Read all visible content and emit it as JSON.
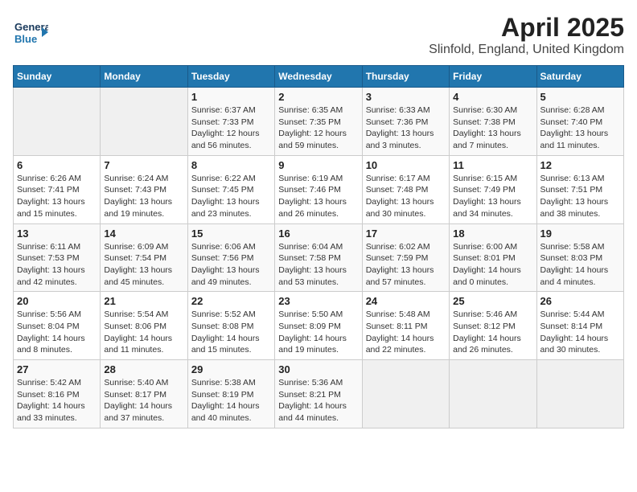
{
  "header": {
    "logo_general": "General",
    "logo_blue": "Blue",
    "title": "April 2025",
    "subtitle": "Slinfold, England, United Kingdom"
  },
  "days_of_week": [
    "Sunday",
    "Monday",
    "Tuesday",
    "Wednesday",
    "Thursday",
    "Friday",
    "Saturday"
  ],
  "weeks": [
    [
      {
        "day": "",
        "empty": true
      },
      {
        "day": "",
        "empty": true
      },
      {
        "day": "1",
        "sunrise": "6:37 AM",
        "sunset": "7:33 PM",
        "daylight": "12 hours and 56 minutes."
      },
      {
        "day": "2",
        "sunrise": "6:35 AM",
        "sunset": "7:35 PM",
        "daylight": "12 hours and 59 minutes."
      },
      {
        "day": "3",
        "sunrise": "6:33 AM",
        "sunset": "7:36 PM",
        "daylight": "13 hours and 3 minutes."
      },
      {
        "day": "4",
        "sunrise": "6:30 AM",
        "sunset": "7:38 PM",
        "daylight": "13 hours and 7 minutes."
      },
      {
        "day": "5",
        "sunrise": "6:28 AM",
        "sunset": "7:40 PM",
        "daylight": "13 hours and 11 minutes."
      }
    ],
    [
      {
        "day": "6",
        "sunrise": "6:26 AM",
        "sunset": "7:41 PM",
        "daylight": "13 hours and 15 minutes."
      },
      {
        "day": "7",
        "sunrise": "6:24 AM",
        "sunset": "7:43 PM",
        "daylight": "13 hours and 19 minutes."
      },
      {
        "day": "8",
        "sunrise": "6:22 AM",
        "sunset": "7:45 PM",
        "daylight": "13 hours and 23 minutes."
      },
      {
        "day": "9",
        "sunrise": "6:19 AM",
        "sunset": "7:46 PM",
        "daylight": "13 hours and 26 minutes."
      },
      {
        "day": "10",
        "sunrise": "6:17 AM",
        "sunset": "7:48 PM",
        "daylight": "13 hours and 30 minutes."
      },
      {
        "day": "11",
        "sunrise": "6:15 AM",
        "sunset": "7:49 PM",
        "daylight": "13 hours and 34 minutes."
      },
      {
        "day": "12",
        "sunrise": "6:13 AM",
        "sunset": "7:51 PM",
        "daylight": "13 hours and 38 minutes."
      }
    ],
    [
      {
        "day": "13",
        "sunrise": "6:11 AM",
        "sunset": "7:53 PM",
        "daylight": "13 hours and 42 minutes."
      },
      {
        "day": "14",
        "sunrise": "6:09 AM",
        "sunset": "7:54 PM",
        "daylight": "13 hours and 45 minutes."
      },
      {
        "day": "15",
        "sunrise": "6:06 AM",
        "sunset": "7:56 PM",
        "daylight": "13 hours and 49 minutes."
      },
      {
        "day": "16",
        "sunrise": "6:04 AM",
        "sunset": "7:58 PM",
        "daylight": "13 hours and 53 minutes."
      },
      {
        "day": "17",
        "sunrise": "6:02 AM",
        "sunset": "7:59 PM",
        "daylight": "13 hours and 57 minutes."
      },
      {
        "day": "18",
        "sunrise": "6:00 AM",
        "sunset": "8:01 PM",
        "daylight": "14 hours and 0 minutes."
      },
      {
        "day": "19",
        "sunrise": "5:58 AM",
        "sunset": "8:03 PM",
        "daylight": "14 hours and 4 minutes."
      }
    ],
    [
      {
        "day": "20",
        "sunrise": "5:56 AM",
        "sunset": "8:04 PM",
        "daylight": "14 hours and 8 minutes."
      },
      {
        "day": "21",
        "sunrise": "5:54 AM",
        "sunset": "8:06 PM",
        "daylight": "14 hours and 11 minutes."
      },
      {
        "day": "22",
        "sunrise": "5:52 AM",
        "sunset": "8:08 PM",
        "daylight": "14 hours and 15 minutes."
      },
      {
        "day": "23",
        "sunrise": "5:50 AM",
        "sunset": "8:09 PM",
        "daylight": "14 hours and 19 minutes."
      },
      {
        "day": "24",
        "sunrise": "5:48 AM",
        "sunset": "8:11 PM",
        "daylight": "14 hours and 22 minutes."
      },
      {
        "day": "25",
        "sunrise": "5:46 AM",
        "sunset": "8:12 PM",
        "daylight": "14 hours and 26 minutes."
      },
      {
        "day": "26",
        "sunrise": "5:44 AM",
        "sunset": "8:14 PM",
        "daylight": "14 hours and 30 minutes."
      }
    ],
    [
      {
        "day": "27",
        "sunrise": "5:42 AM",
        "sunset": "8:16 PM",
        "daylight": "14 hours and 33 minutes."
      },
      {
        "day": "28",
        "sunrise": "5:40 AM",
        "sunset": "8:17 PM",
        "daylight": "14 hours and 37 minutes."
      },
      {
        "day": "29",
        "sunrise": "5:38 AM",
        "sunset": "8:19 PM",
        "daylight": "14 hours and 40 minutes."
      },
      {
        "day": "30",
        "sunrise": "5:36 AM",
        "sunset": "8:21 PM",
        "daylight": "14 hours and 44 minutes."
      },
      {
        "day": "",
        "empty": true
      },
      {
        "day": "",
        "empty": true
      },
      {
        "day": "",
        "empty": true
      }
    ]
  ]
}
